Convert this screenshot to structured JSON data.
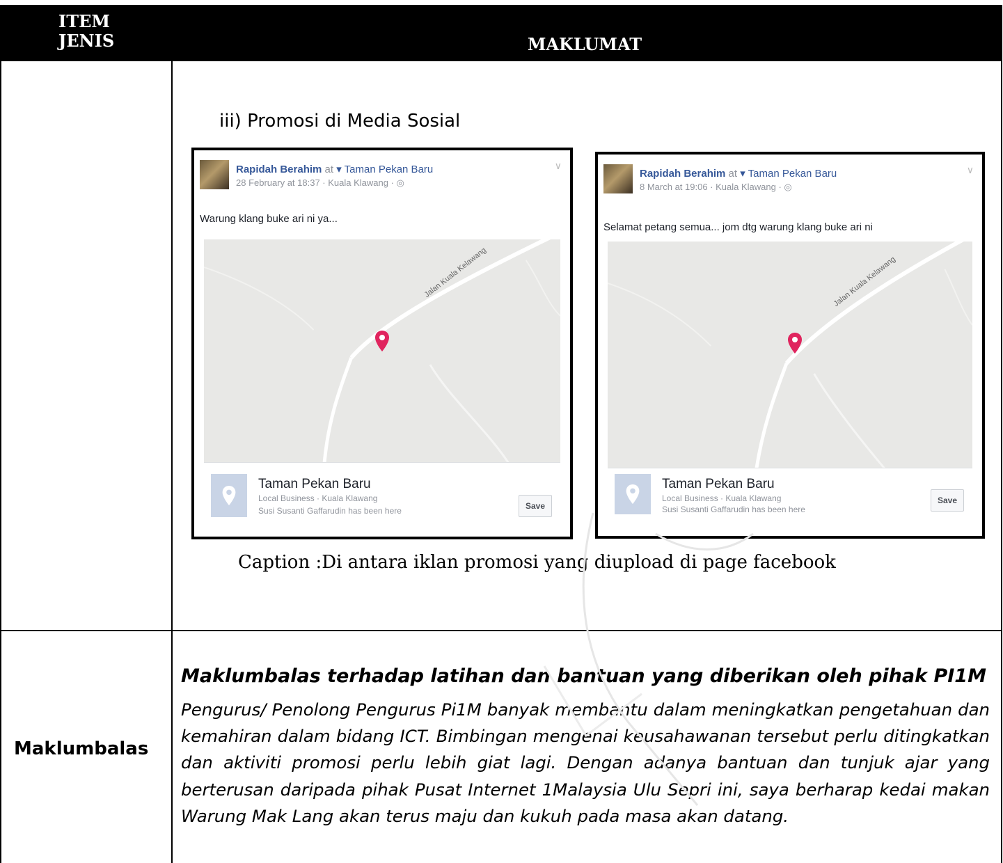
{
  "header": {
    "col1_line1": "ITEM",
    "col1_line2": "JENIS",
    "col2": "MAKLUMAT"
  },
  "section": {
    "title": "iii) Promosi di Media Sosial",
    "caption": "Caption :Di antara iklan promosi yang diupload di page facebook"
  },
  "posts": [
    {
      "author": "Rapidah Berahim",
      "at": "at",
      "location": "Taman Pekan Baru",
      "meta": "28 February at 18:37 · Kuala Klawang ·",
      "text": "Warung klang buke ari ni ya...",
      "road": "Jalan Kuala Kelawang",
      "place_name": "Taman Pekan Baru",
      "place_sub": "Local Business · Kuala Klawang",
      "place_friend": "Susi Susanti Gaffarudin has been here",
      "save": "Save"
    },
    {
      "author": "Rapidah Berahim",
      "at": "at",
      "location": "Taman Pekan Baru",
      "meta": "8 March at 19:06 · Kuala Klawang ·",
      "text": "Selamat petang semua... jom dtg warung klang buke ari ni",
      "road": "Jalan Kuala Kelawang",
      "place_name": "Taman Pekan Baru",
      "place_sub": "Local Business · Kuala Klawang",
      "place_friend": "Susi Susanti Gaffarudin has been here",
      "save": "Save"
    }
  ],
  "feedback": {
    "label": "Maklumbalas",
    "title": "Maklumbalas terhadap latihan dan bantuan yang diberikan oleh pihak PI1M",
    "body": "Pengurus/ Penolong Pengurus Pi1M banyak membantu dalam meningkatkan pengetahuan dan kemahiran dalam bidang ICT. Bimbingan mengenai keusahawanan tersebut perlu ditingkatkan dan aktiviti promosi perlu lebih giat lagi.  Dengan adanya bantuan dan tunjuk ajar yang berterusan daripada pihak Pusat Internet 1Malaysia Ulu Sepri ini, saya berharap kedai makan Warung Mak Lang akan terus maju dan kukuh pada masa akan datang."
  },
  "colors": {
    "header_bg": "#000000",
    "fb_link": "#365899",
    "map_pin": "#e0245e"
  },
  "icons": [
    "location-pin-icon",
    "globe-icon",
    "chevron-down-icon",
    "map-marker-icon",
    "place-pin-icon"
  ]
}
